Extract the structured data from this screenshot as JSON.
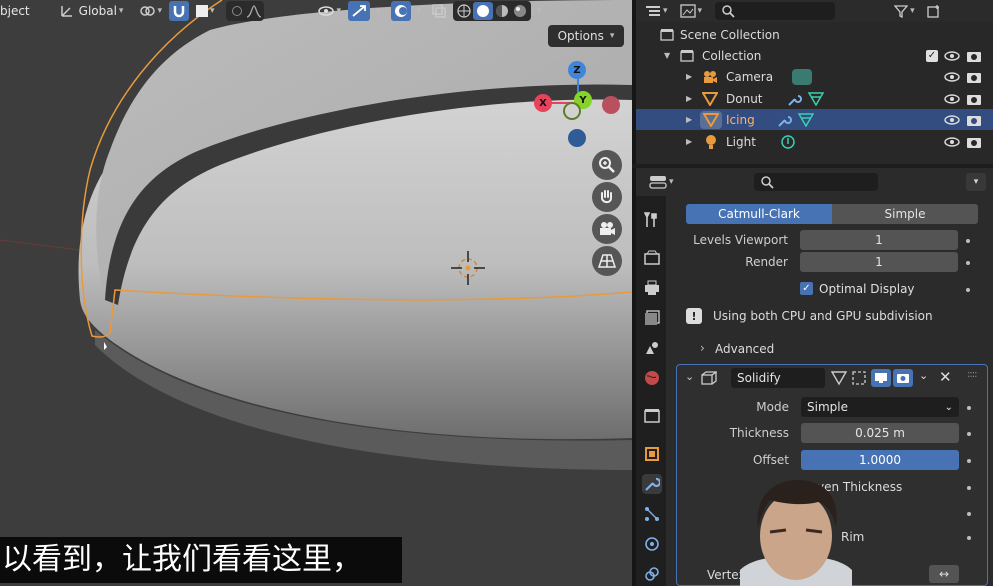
{
  "viewport": {
    "header": {
      "mode_label": "bject",
      "transform_orientation": "Global",
      "options_label": "Options"
    },
    "gizmo": {
      "x": "X",
      "y": "Y",
      "z": "Z"
    },
    "subtitle": "以看到，让我们看看这里，"
  },
  "outliner": {
    "items": [
      {
        "label": "Scene Collection"
      },
      {
        "label": "Collection"
      },
      {
        "label": "Camera"
      },
      {
        "label": "Donut"
      },
      {
        "label": "Icing"
      },
      {
        "label": "Light"
      }
    ]
  },
  "properties": {
    "subdivision": {
      "tab_catmull": "Catmull-Clark",
      "tab_simple": "Simple",
      "levels_viewport_label": "Levels Viewport",
      "levels_viewport_value": "1",
      "render_label": "Render",
      "render_value": "1",
      "optimal_display_label": "Optimal Display",
      "info_text": "Using both CPU and GPU subdivision",
      "advanced_label": "Advanced"
    },
    "solidify": {
      "name": "Solidify",
      "mode_label": "Mode",
      "mode_value": "Simple",
      "thickness_label": "Thickness",
      "thickness_value": "0.025 m",
      "offset_label": "Offset",
      "offset_value": "1.0000",
      "even_thickness_label": "ven Thickness",
      "rim_label": "Rim",
      "vertex_label": "Vertex"
    }
  },
  "colors": {
    "accent": "#4772b3",
    "selection_orange": "#e89a3c",
    "axis_x": "#e8435d",
    "axis_y": "#86d42a",
    "axis_z": "#3f86db"
  }
}
